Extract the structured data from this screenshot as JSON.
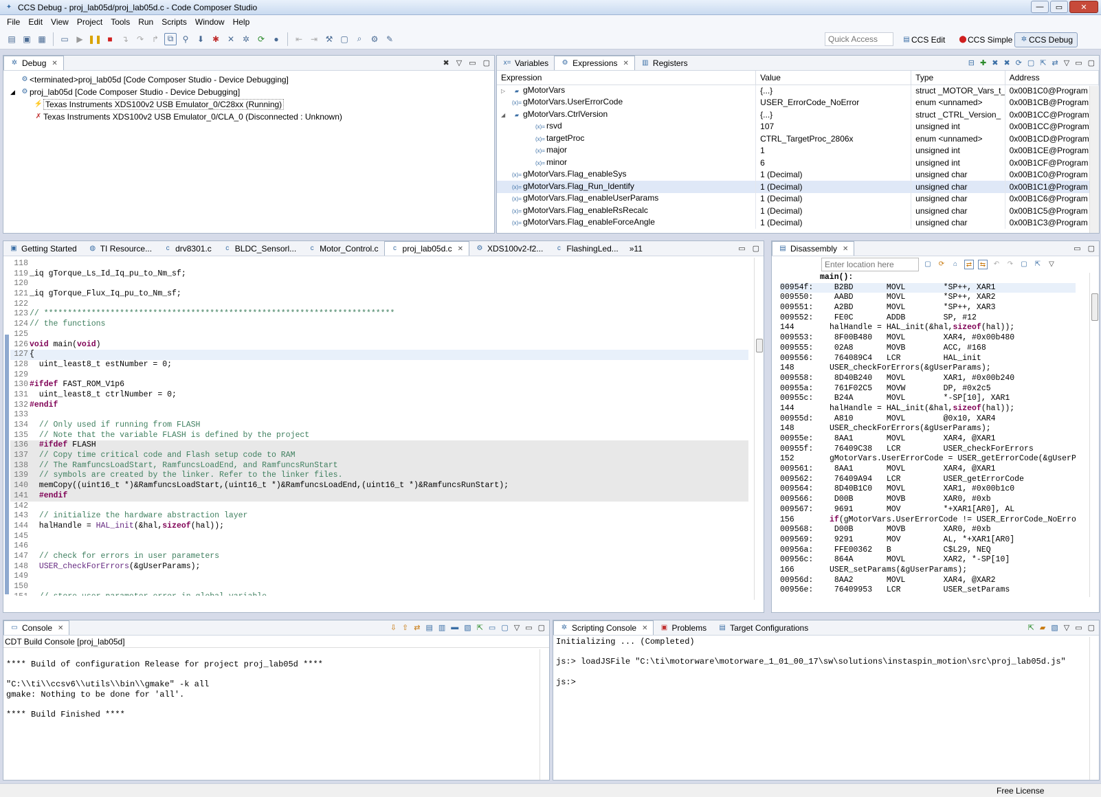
{
  "window": {
    "title": "CCS Debug - proj_lab05d/proj_lab05d.c - Code Composer Studio",
    "min": "—",
    "max": "▭",
    "close": "✕"
  },
  "menu": [
    "File",
    "Edit",
    "View",
    "Project",
    "Tools",
    "Run",
    "Scripts",
    "Window",
    "Help"
  ],
  "quick_access": "Quick Access",
  "perspectives": {
    "edit": "CCS Edit",
    "simple": "CCS Simple",
    "debug": "CCS Debug"
  },
  "debug": {
    "tab": "Debug",
    "items": [
      "<terminated>proj_lab05d [Code Composer Studio - Device Debugging]",
      "proj_lab05d [Code Composer Studio - Device Debugging]",
      "Texas Instruments XDS100v2 USB Emulator_0/C28xx (Running)",
      "Texas Instruments XDS100v2 USB Emulator_0/CLA_0 (Disconnected : Unknown)"
    ]
  },
  "expr_tabs": [
    "Variables",
    "Expressions",
    "Registers"
  ],
  "expr_headers": [
    "Expression",
    "Value",
    "Type",
    "Address"
  ],
  "expressions": [
    [
      "▷",
      "gMotorVars",
      "{...}",
      "struct _MOTOR_Vars_t_",
      "0x00B1C0@Program"
    ],
    [
      "",
      "gMotorVars.UserErrorCode",
      "USER_ErrorCode_NoError",
      "enum <unnamed>",
      "0x00B1CB@Program"
    ],
    [
      "◢",
      "gMotorVars.CtrlVersion",
      "{...}",
      "struct _CTRL_Version_",
      "0x00B1CC@Program"
    ],
    [
      "  ",
      "rsvd",
      "107",
      "unsigned int",
      "0x00B1CC@Program"
    ],
    [
      "  ",
      "targetProc",
      "CTRL_TargetProc_2806x",
      "enum <unnamed>",
      "0x00B1CD@Program"
    ],
    [
      "  ",
      "major",
      "1",
      "unsigned int",
      "0x00B1CE@Program"
    ],
    [
      "  ",
      "minor",
      "6",
      "unsigned int",
      "0x00B1CF@Program"
    ],
    [
      "",
      "gMotorVars.Flag_enableSys",
      "1 (Decimal)",
      "unsigned char",
      "0x00B1C0@Program"
    ],
    [
      "",
      "gMotorVars.Flag_Run_Identify",
      "1 (Decimal)",
      "unsigned char",
      "0x00B1C1@Program"
    ],
    [
      "",
      "gMotorVars.Flag_enableUserParams",
      "1 (Decimal)",
      "unsigned char",
      "0x00B1C6@Program"
    ],
    [
      "",
      "gMotorVars.Flag_enableRsRecalc",
      "1 (Decimal)",
      "unsigned char",
      "0x00B1C5@Program"
    ],
    [
      "",
      "gMotorVars.Flag_enableForceAngle",
      "1 (Decimal)",
      "unsigned char",
      "0x00B1C3@Program"
    ]
  ],
  "editor_tabs": [
    "Getting Started",
    "TI Resource...",
    "drv8301.c",
    "BLDC_Sensorl...",
    "Motor_Control.c",
    "proj_lab05d.c",
    "XDS100v2-f2...",
    "FlashingLed..."
  ],
  "editor_overflow": "»11",
  "code": [
    [
      "118",
      ""
    ],
    [
      "119",
      "_iq gTorque_Ls_Id_Iq_pu_to_Nm_sf;"
    ],
    [
      "120",
      ""
    ],
    [
      "121",
      "_iq gTorque_Flux_Iq_pu_to_Nm_sf;"
    ],
    [
      "122",
      ""
    ],
    [
      "123",
      "// **************************************************************************"
    ],
    [
      "124",
      "// the functions"
    ],
    [
      "125",
      ""
    ],
    [
      "126",
      "void main(void)"
    ],
    [
      "127",
      "{"
    ],
    [
      "128",
      "  uint_least8_t estNumber = 0;"
    ],
    [
      "129",
      ""
    ],
    [
      "130",
      "#ifdef FAST_ROM_V1p6"
    ],
    [
      "131",
      "  uint_least8_t ctrlNumber = 0;"
    ],
    [
      "132",
      "#endif"
    ],
    [
      "133",
      ""
    ],
    [
      "134",
      "  // Only used if running from FLASH"
    ],
    [
      "135",
      "  // Note that the variable FLASH is defined by the project"
    ],
    [
      "136",
      "  #ifdef FLASH"
    ],
    [
      "137",
      "  // Copy time critical code and Flash setup code to RAM"
    ],
    [
      "138",
      "  // The RamfuncsLoadStart, RamfuncsLoadEnd, and RamfuncsRunStart"
    ],
    [
      "139",
      "  // symbols are created by the linker. Refer to the linker files."
    ],
    [
      "140",
      "  memCopy((uint16_t *)&RamfuncsLoadStart,(uint16_t *)&RamfuncsLoadEnd,(uint16_t *)&RamfuncsRunStart);"
    ],
    [
      "141",
      "  #endif"
    ],
    [
      "142",
      ""
    ],
    [
      "143",
      "  // initialize the hardware abstraction layer"
    ],
    [
      "144",
      "  halHandle = HAL_init(&hal,sizeof(hal));"
    ],
    [
      "145",
      ""
    ],
    [
      "146",
      ""
    ],
    [
      "147",
      "  // check for errors in user parameters"
    ],
    [
      "148",
      "  USER_checkForErrors(&gUserParams);"
    ],
    [
      "149",
      ""
    ],
    [
      "150",
      ""
    ],
    [
      "151",
      "  // store user parameter error in global variable"
    ]
  ],
  "disasm": {
    "tab": "Disassembly",
    "location_placeholder": "Enter location here",
    "lines": [
      [
        "",
        "main():"
      ],
      [
        "00954f:",
        "B2BD       MOVL        *SP++, XAR1"
      ],
      [
        "009550:",
        "AABD       MOVL        *SP++, XAR2"
      ],
      [
        "009551:",
        "A2BD       MOVL        *SP++, XAR3"
      ],
      [
        "009552:",
        "FE0C       ADDB        SP, #12"
      ],
      [
        "144",
        "halHandle = HAL_init(&hal,sizeof(hal));"
      ],
      [
        "009553:",
        "8F00B480   MOVL        XAR4, #0x00b480"
      ],
      [
        "009555:",
        "02A8       MOVB        ACC, #168"
      ],
      [
        "009556:",
        "764089C4   LCR         HAL_init"
      ],
      [
        "148",
        "USER_checkForErrors(&gUserParams);"
      ],
      [
        "009558:",
        "8D40B240   MOVL        XAR1, #0x00b240"
      ],
      [
        "00955a:",
        "761F02C5   MOVW        DP, #0x2c5"
      ],
      [
        "00955c:",
        "B24A       MOVL        *-SP[10], XAR1"
      ],
      [
        "144",
        "halHandle = HAL_init(&hal,sizeof(hal));"
      ],
      [
        "00955d:",
        "A810       MOVL        @0x10, XAR4"
      ],
      [
        "148",
        "USER_checkForErrors(&gUserParams);"
      ],
      [
        "00955e:",
        "8AA1       MOVL        XAR4, @XAR1"
      ],
      [
        "00955f:",
        "76409C38   LCR         USER_checkForErrors"
      ],
      [
        "152",
        "gMotorVars.UserErrorCode = USER_getErrorCode(&gUserP"
      ],
      [
        "009561:",
        "8AA1       MOVL        XAR4, @XAR1"
      ],
      [
        "009562:",
        "76409A94   LCR         USER_getErrorCode"
      ],
      [
        "009564:",
        "8D40B1C0   MOVL        XAR1, #0x00b1c0"
      ],
      [
        "009566:",
        "D00B       MOVB        XAR0, #0xb"
      ],
      [
        "009567:",
        "9691       MOV         *+XAR1[AR0], AL"
      ],
      [
        "156",
        "if(gMotorVars.UserErrorCode != USER_ErrorCode_NoErro"
      ],
      [
        "009568:",
        "D00B       MOVB        XAR0, #0xb"
      ],
      [
        "009569:",
        "9291       MOV         AL, *+XAR1[AR0]"
      ],
      [
        "00956a:",
        "FFE00362   B           C$L29, NEQ"
      ],
      [
        "00956c:",
        "864A       MOVL        XAR2, *-SP[10]"
      ],
      [
        "166",
        "USER_setParams(&gUserParams);"
      ],
      [
        "00956d:",
        "8AA2       MOVL        XAR4, @XAR2"
      ],
      [
        "00956e:",
        "76409953   LCR         USER_setParams"
      ]
    ]
  },
  "console": {
    "tab": "Console",
    "title": "CDT Build Console [proj_lab05d]",
    "lines": [
      "",
      "**** Build of configuration Release for project proj_lab05d ****",
      "",
      "\"C:\\\\ti\\\\ccsv6\\\\utils\\\\bin\\\\gmake\" -k all",
      "gmake: Nothing to be done for 'all'.",
      "",
      "**** Build Finished ****"
    ]
  },
  "script": {
    "tabs": [
      "Scripting Console",
      "Problems",
      "Target Configurations"
    ],
    "lines": [
      "Initializing ... (Completed)",
      "",
      "js:> loadJSFile \"C:\\ti\\motorware\\motorware_1_01_00_17\\sw\\solutions\\instaspin_motion\\src\\proj_lab05d.js\"",
      "",
      "js:>"
    ]
  },
  "status": {
    "license": "Free License"
  }
}
